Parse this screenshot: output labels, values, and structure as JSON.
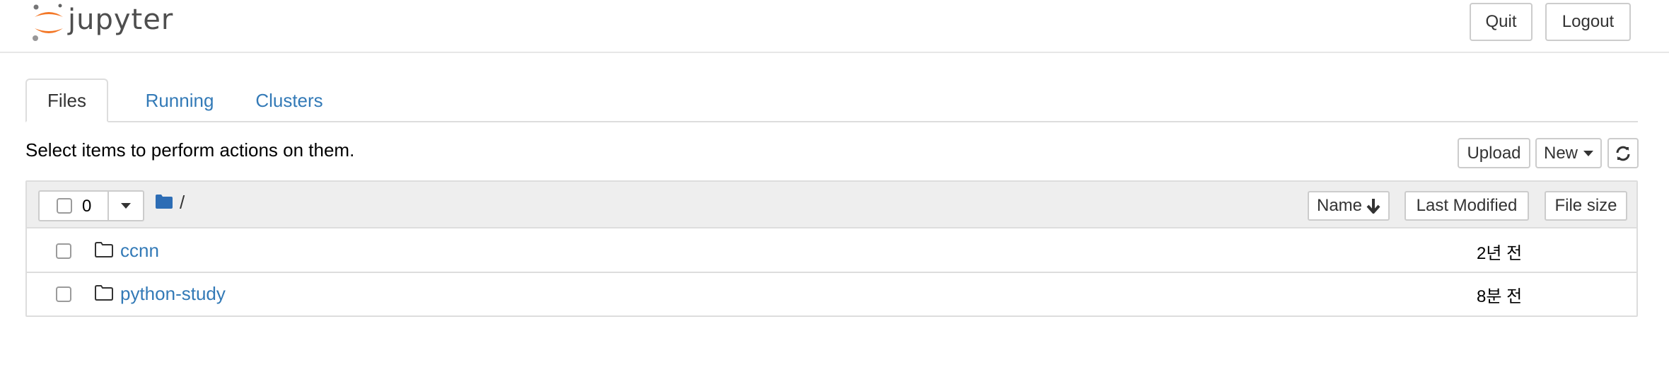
{
  "header": {
    "logo_text": "jupyter",
    "quit_label": "Quit",
    "logout_label": "Logout"
  },
  "tabs": [
    {
      "label": "Files",
      "active": true
    },
    {
      "label": "Running",
      "active": false
    },
    {
      "label": "Clusters",
      "active": false
    }
  ],
  "toolbar": {
    "instruction": "Select items to perform actions on them.",
    "upload_label": "Upload",
    "new_label": "New",
    "refresh_icon": "refresh-icon"
  },
  "list_header": {
    "selected_count": "0",
    "breadcrumb_root": "/",
    "sort_name_label": "Name",
    "sort_modified_label": "Last Modified",
    "sort_size_label": "File size"
  },
  "items": [
    {
      "name": "ccnn",
      "type": "folder",
      "modified": "2년 전"
    },
    {
      "name": "python-study",
      "type": "folder",
      "modified": "8분 전"
    }
  ],
  "colors": {
    "link": "#337ab7",
    "folder_icon": "#2d6db5",
    "logo_orange": "#f37726",
    "header_bg": "#eeeeee",
    "border": "#dddddd"
  }
}
